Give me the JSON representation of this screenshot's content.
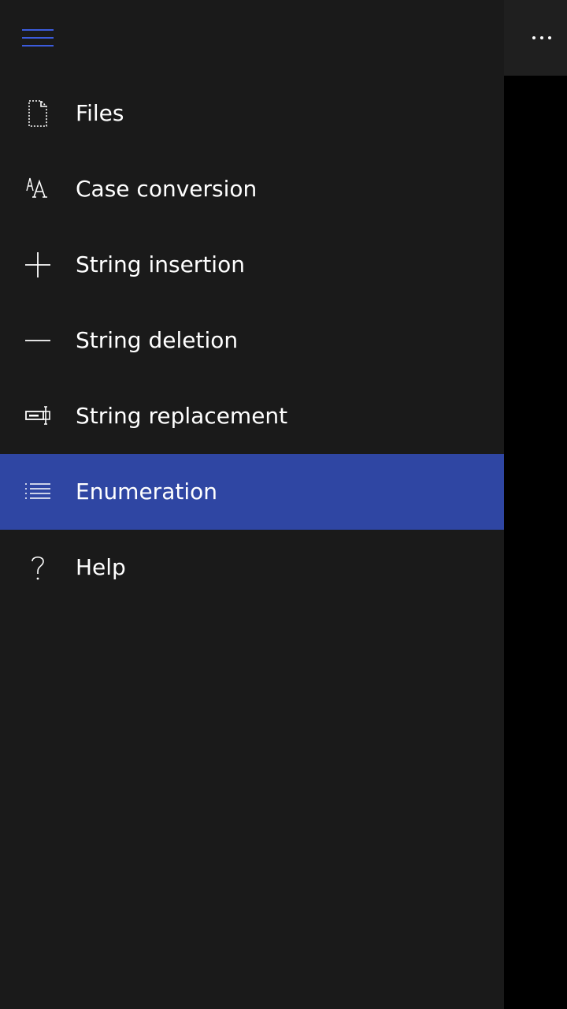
{
  "accent_color": "#2f46a3",
  "menu": {
    "hamburger_icon": "hamburger-icon",
    "items": [
      {
        "label": "Files",
        "icon": "file-icon"
      },
      {
        "label": "Case conversion",
        "icon": "font-size-icon"
      },
      {
        "label": "String insertion",
        "icon": "plus-icon"
      },
      {
        "label": "String deletion",
        "icon": "minus-icon"
      },
      {
        "label": "String replacement",
        "icon": "rename-icon"
      },
      {
        "label": "Enumeration",
        "icon": "list-icon",
        "selected": true
      },
      {
        "label": "Help",
        "icon": "question-icon"
      }
    ]
  },
  "appbar": {
    "more_icon": "more-icon"
  }
}
